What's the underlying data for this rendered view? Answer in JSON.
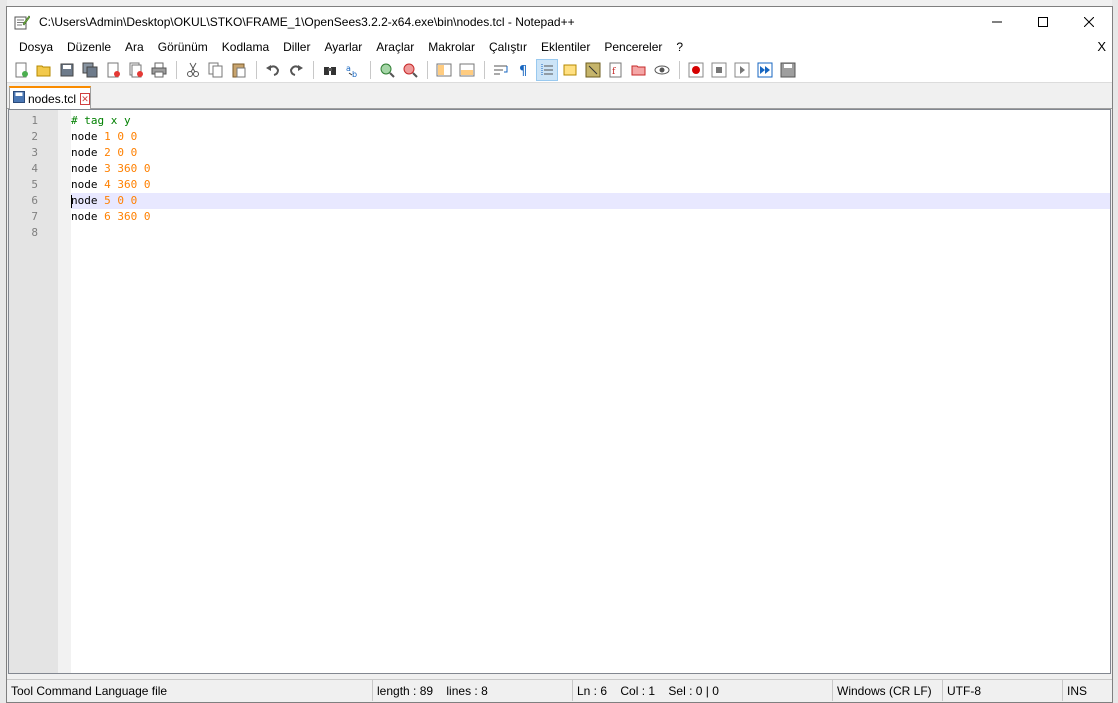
{
  "window": {
    "title": "C:\\Users\\Admin\\Desktop\\OKUL\\STKO\\FRAME_1\\OpenSees3.2.2-x64.exe\\bin\\nodes.tcl - Notepad++",
    "minimize_icon": "minimize-icon",
    "maximize_icon": "maximize-icon",
    "close_icon": "close-icon"
  },
  "menu": {
    "items": [
      "Dosya",
      "Düzenle",
      "Ara",
      "Görünüm",
      "Kodlama",
      "Diller",
      "Ayarlar",
      "Araçlar",
      "Makrolar",
      "Çalıştır",
      "Eklentiler",
      "Pencereler",
      "?"
    ],
    "close": "X"
  },
  "toolbar": {
    "buttons": [
      "new-file-icon",
      "open-file-icon",
      "save-icon",
      "save-all-icon",
      "close-icon",
      "close-all-icon",
      "print-icon",
      "cut-icon",
      "copy-icon",
      "paste-icon",
      "undo-icon",
      "redo-icon",
      "find-icon",
      "replace-icon",
      "zoom-in-icon",
      "zoom-out-icon",
      "sync-vertical-icon",
      "sync-horizontal-icon",
      "word-wrap-icon",
      "show-all-chars-icon",
      "indent-guide-icon",
      "user-language-icon",
      "document-map-icon",
      "function-list-icon",
      "folder-workspace-icon",
      "monitoring-icon",
      "record-macro-icon",
      "stop-macro-icon",
      "play-macro-icon",
      "run-macro-multiple-icon",
      "save-macro-icon"
    ]
  },
  "tab": {
    "label": "nodes.tcl",
    "close": "✕"
  },
  "editor": {
    "line_numbers": [
      "1",
      "2",
      "3",
      "4",
      "5",
      "6",
      "7",
      "8"
    ],
    "lines": [
      {
        "comment": "# tag x y"
      },
      {
        "kw": "node",
        "args": "1 0 0"
      },
      {
        "kw": "node",
        "args": "2 0 0"
      },
      {
        "kw": "node",
        "args": "3 360 0"
      },
      {
        "kw": "node",
        "args": "4 360 0"
      },
      {
        "kw": "node",
        "args": "5 0 0"
      },
      {
        "kw": "node",
        "args": "6 360 0"
      },
      {
        "kw": "",
        "args": ""
      }
    ],
    "current_line": 6
  },
  "status": {
    "filetype": "Tool Command Language file",
    "length": "length : 89",
    "lines": "lines : 8",
    "ln": "Ln : 6",
    "col": "Col : 1",
    "sel": "Sel : 0 | 0",
    "eol": "Windows (CR LF)",
    "encoding": "UTF-8",
    "mode": "INS"
  },
  "colors": {
    "comment": "#008000",
    "number": "#ff8000",
    "current_line_bg": "#e8e8ff",
    "tab_accent": "#fa8c00"
  }
}
